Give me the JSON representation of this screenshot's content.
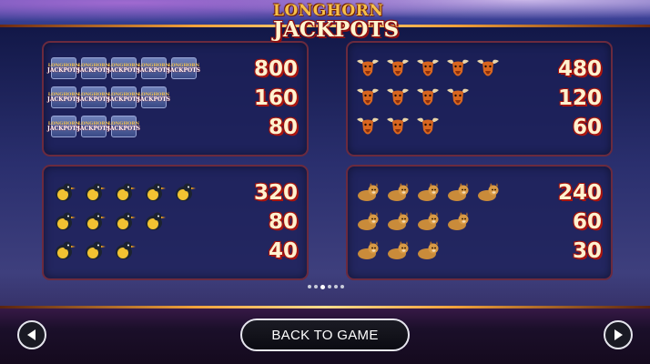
{
  "logo": {
    "line1": "LONGHORN",
    "line2": "JACKPOTS"
  },
  "paytable": [
    {
      "id": "jackpot",
      "symbol": "longhorn-jackpots-logo",
      "payouts": [
        "800",
        "160",
        "80"
      ]
    },
    {
      "id": "bull",
      "symbol": "bull-head-icon",
      "payouts": [
        "480",
        "120",
        "60"
      ]
    },
    {
      "id": "bird",
      "symbol": "bird-icon",
      "payouts": [
        "320",
        "80",
        "40"
      ]
    },
    {
      "id": "cat",
      "symbol": "cougar-icon",
      "payouts": [
        "240",
        "60",
        "30"
      ]
    }
  ],
  "pager": {
    "count": 6,
    "active_index": 2
  },
  "footer": {
    "back_label": "BACK TO GAME"
  },
  "colors": {
    "panel_border": "#6b2a3e",
    "payout_outline": "#b3170f",
    "payout_fill": "#fff2cf"
  }
}
